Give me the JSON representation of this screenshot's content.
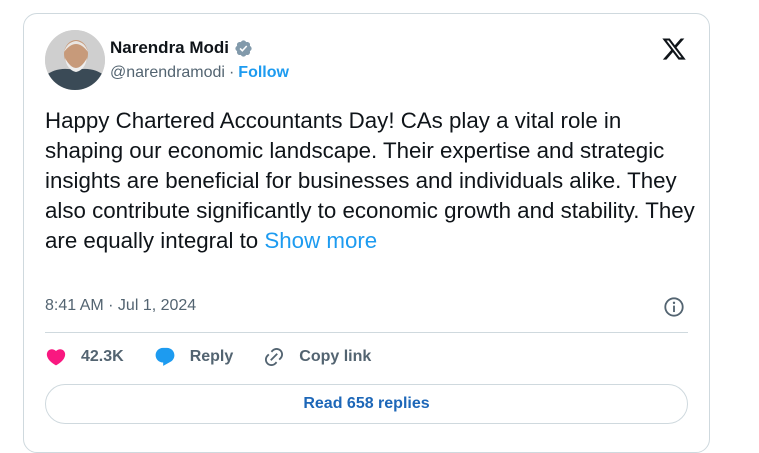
{
  "tweet": {
    "author_name": "Narendra Modi",
    "handle": "@narendramodi",
    "separator": "·",
    "follow_label": "Follow",
    "text": "Happy Chartered Accountants Day! CAs play a vital role in shaping our economic landscape. Their expertise and strategic insights are beneficial for businesses and individuals alike. They also contribute significantly to economic growth and stability. They are equally integral to",
    "show_more_label": "Show more",
    "timestamp": "8:41 AM · Jul 1, 2024",
    "likes": "42.3K",
    "reply_label": "Reply",
    "copy_link_label": "Copy link",
    "read_replies_label": "Read 658 replies"
  },
  "icons": {
    "verified": "verified-badge-icon",
    "platform": "x-logo-icon",
    "info": "info-icon",
    "like": "heart-icon",
    "reply": "speech-bubble-icon",
    "link": "link-icon"
  },
  "colors": {
    "accent": "#1d9bf0",
    "like": "#f91880",
    "muted": "#536471",
    "text": "#0f1419",
    "border": "#cfd9de"
  }
}
